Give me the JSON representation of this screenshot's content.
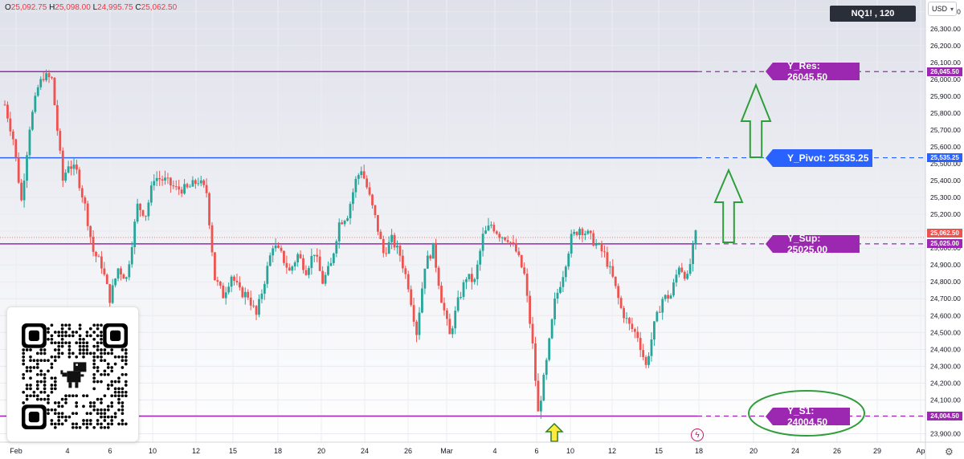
{
  "header": {
    "ohlc": {
      "o_label": "O",
      "o": "25,092.75",
      "h_label": "H",
      "h": "25,098.00",
      "l_label": "L",
      "l": "24,995.75",
      "c_label": "C",
      "c": "25,062.50"
    },
    "symbol_badge": "NQ1! , 120",
    "currency": "USD"
  },
  "colors": {
    "purple": "#9c27b0",
    "blue": "#2962ff",
    "up": "#26a69a",
    "down": "#ef5350",
    "arrow_green": "#2e9e3a",
    "arrow_yellow": "#ffeb3b"
  },
  "levels": [
    {
      "label": "Y_Res: 26045.50",
      "price": 26045.5,
      "axis_label": "26,045.50",
      "color": "purple"
    },
    {
      "label": "Y_Pivot: 25535.25",
      "price": 25535.25,
      "axis_label": "25,535.25",
      "color": "blue"
    },
    {
      "label": "Y_Sup: 25025.00",
      "price": 25025.0,
      "axis_label": "25,025.00",
      "color": "purple"
    },
    {
      "label": "Y_S1: 24004.50",
      "price": 24004.5,
      "axis_label": "24,004.50",
      "color": "purple"
    }
  ],
  "last_price": {
    "value": 25062.5,
    "axis_label": "25,062.50"
  },
  "chart_data": {
    "type": "candlestick",
    "y_axis": {
      "ticks": [
        "26,400.00",
        "26,300.00",
        "26,200.00",
        "26,100.00",
        "26,000.00",
        "25,900.00",
        "25,800.00",
        "25,700.00",
        "25,600.00",
        "25,500.00",
        "25,400.00",
        "25,300.00",
        "25,200.00",
        "25,100.00",
        "25,000.00",
        "24,900.00",
        "24,800.00",
        "24,700.00",
        "24,600.00",
        "24,500.00",
        "24,400.00",
        "24,300.00",
        "24,200.00",
        "24,100.00",
        "24,000.00",
        "23,900.00"
      ],
      "ylim": [
        23850,
        26470
      ]
    },
    "x_axis": {
      "ticks": [
        "Feb",
        "4",
        "6",
        "10",
        "12",
        "15",
        "18",
        "20",
        "24",
        "26",
        "Mar",
        "4",
        "6",
        "10",
        "12",
        "15",
        "18",
        "20",
        "24",
        "26",
        "29",
        "Ap"
      ]
    },
    "anchors": [
      [
        0,
        25850
      ],
      [
        3,
        25650
      ],
      [
        6,
        25280
      ],
      [
        9,
        25720
      ],
      [
        12,
        25950
      ],
      [
        14,
        26020
      ],
      [
        17,
        26000
      ],
      [
        19,
        25700
      ],
      [
        21,
        25400
      ],
      [
        23,
        25500
      ],
      [
        26,
        25450
      ],
      [
        29,
        25250
      ],
      [
        32,
        24980
      ],
      [
        35,
        24900
      ],
      [
        38,
        24700
      ],
      [
        41,
        24880
      ],
      [
        44,
        24820
      ],
      [
        48,
        25250
      ],
      [
        51,
        25200
      ],
      [
        54,
        25420
      ],
      [
        58,
        25400
      ],
      [
        62,
        25350
      ],
      [
        66,
        25350
      ],
      [
        70,
        25400
      ],
      [
        73,
        25330
      ],
      [
        76,
        24820
      ],
      [
        79,
        24720
      ],
      [
        82,
        24840
      ],
      [
        85,
        24740
      ],
      [
        88,
        24720
      ],
      [
        91,
        24600
      ],
      [
        94,
        24810
      ],
      [
        97,
        25020
      ],
      [
        100,
        24960
      ],
      [
        103,
        24860
      ],
      [
        106,
        24960
      ],
      [
        109,
        24870
      ],
      [
        112,
        24980
      ],
      [
        115,
        24800
      ],
      [
        118,
        24900
      ],
      [
        121,
        25150
      ],
      [
        124,
        25200
      ],
      [
        127,
        25400
      ],
      [
        129,
        25470
      ],
      [
        131,
        25360
      ],
      [
        134,
        25180
      ],
      [
        137,
        24970
      ],
      [
        140,
        25050
      ],
      [
        143,
        24960
      ],
      [
        146,
        24780
      ],
      [
        149,
        24500
      ],
      [
        152,
        24900
      ],
      [
        155,
        25000
      ],
      [
        158,
        24700
      ],
      [
        161,
        24480
      ],
      [
        164,
        24680
      ],
      [
        167,
        24830
      ],
      [
        170,
        24800
      ],
      [
        173,
        25070
      ],
      [
        176,
        25140
      ],
      [
        179,
        25080
      ],
      [
        182,
        25060
      ],
      [
        185,
        24980
      ],
      [
        188,
        24840
      ],
      [
        191,
        24420
      ],
      [
        193,
        24020
      ],
      [
        196,
        24320
      ],
      [
        199,
        24680
      ],
      [
        202,
        24850
      ],
      [
        205,
        25060
      ],
      [
        208,
        25120
      ],
      [
        211,
        25080
      ],
      [
        214,
        25020
      ],
      [
        217,
        24960
      ],
      [
        220,
        24820
      ],
      [
        223,
        24640
      ],
      [
        226,
        24540
      ],
      [
        229,
        24480
      ],
      [
        232,
        24300
      ],
      [
        235,
        24540
      ],
      [
        238,
        24700
      ],
      [
        241,
        24720
      ],
      [
        244,
        24900
      ],
      [
        247,
        24820
      ],
      [
        250,
        25080
      ]
    ],
    "bars": 251,
    "annotations": [
      {
        "type": "arrow-up",
        "color": "arrow_green",
        "position": "near Y_Pivot"
      },
      {
        "type": "arrow-up",
        "color": "arrow_green",
        "position": "near Y_Res"
      },
      {
        "type": "arrow-up",
        "color": "arrow_yellow",
        "position": "bottom at Mar 7 low"
      },
      {
        "type": "ellipse",
        "color": "arrow_green",
        "position": "around Y_S1 label"
      }
    ]
  },
  "qr": {
    "mascot": "dino-icon"
  }
}
